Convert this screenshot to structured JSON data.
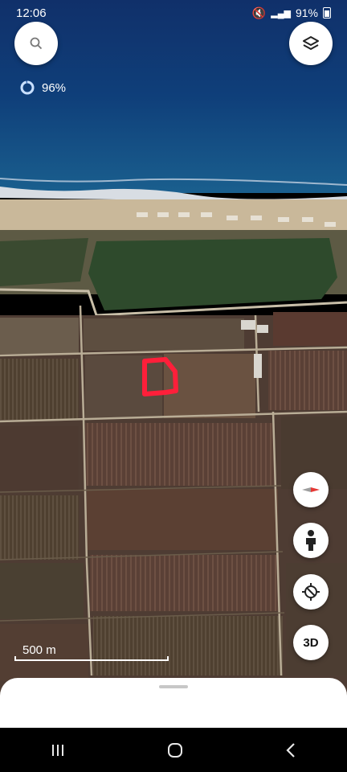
{
  "status_bar": {
    "time": "12:06",
    "battery": "91%"
  },
  "loading": {
    "percent_label": "96%",
    "percent_value": 96
  },
  "scale": {
    "label": "500 m"
  },
  "controls": {
    "three_d_label": "3D"
  },
  "icons": {
    "search": "search-icon",
    "layers": "layers-icon",
    "compass": "compass-icon",
    "street_view": "pegman-icon",
    "my_location": "crosshair-location-icon",
    "recent_apps": "recent-apps-icon",
    "home": "home-icon",
    "back": "back-icon"
  },
  "colors": {
    "accent": "#1a73e8",
    "drawn_shape": "#ff1f3a"
  }
}
